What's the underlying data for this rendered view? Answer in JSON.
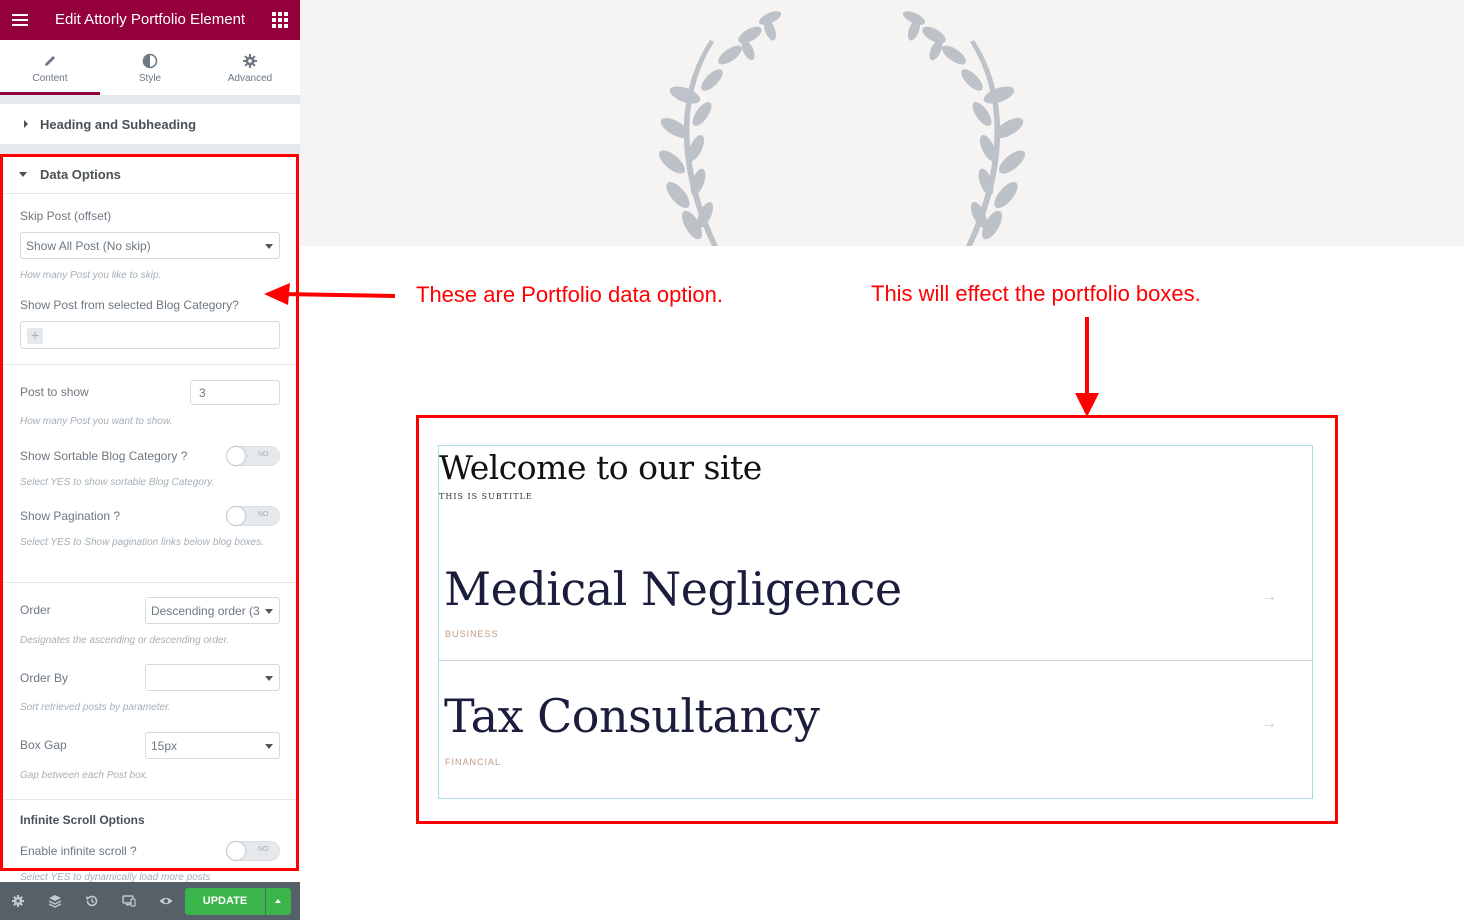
{
  "sidebar": {
    "title": "Edit Attorly Portfolio Element",
    "tabs": [
      {
        "label": "Content",
        "icon": "pencil-icon"
      },
      {
        "label": "Style",
        "icon": "half-circle-icon"
      },
      {
        "label": "Advanced",
        "icon": "gear-icon"
      }
    ],
    "sections": {
      "heading": "Heading and Subheading",
      "data": "Data Options"
    },
    "controls": {
      "skip_label": "Skip Post (offset)",
      "skip_value": "Show All Post (No skip)",
      "skip_help": "How many Post you like to skip.",
      "category_label": "Show Post from selected Blog Category?",
      "post_to_show_label": "Post to show",
      "post_to_show_value": "3",
      "post_to_show_help": "How many Post you want to show.",
      "sortable_label": "Show Sortable Blog Category ?",
      "sortable_toggle": "NO",
      "sortable_help": "Select YES to show sortable Blog Category.",
      "pagination_label": "Show Pagination ?",
      "pagination_toggle": "NO",
      "pagination_help": "Select YES to Show pagination links below blog boxes.",
      "order_label": "Order",
      "order_value": "Descending order (3",
      "order_help": "Designates the ascending or descending order.",
      "orderby_label": "Order By",
      "orderby_value": "",
      "orderby_help": "Sort retrieved posts by parameter.",
      "boxgap_label": "Box Gap",
      "boxgap_value": "15px",
      "boxgap_help": "Gap between each Post box.",
      "infinite_heading": "Infinite Scroll Options",
      "infinite_label": "Enable infinite scroll ?",
      "infinite_toggle": "NO",
      "infinite_help": "Select YES to dynamically load more posts"
    },
    "footer": {
      "update_label": "UPDATE"
    }
  },
  "annotations": {
    "left_note": "These are Portfolio data option.",
    "right_note": "This will effect the portfolio boxes."
  },
  "portfolio": {
    "title": "Welcome to our site",
    "subtitle": "THIS IS SUBTITLE",
    "items": [
      {
        "name": "Medical Negligence",
        "category": "BUSINESS"
      },
      {
        "name": "Tax Consultancy",
        "category": "FINANCIAL"
      }
    ]
  },
  "colors": {
    "brand": "#93003c",
    "annotation": "#ff0000",
    "update": "#39b54a"
  }
}
